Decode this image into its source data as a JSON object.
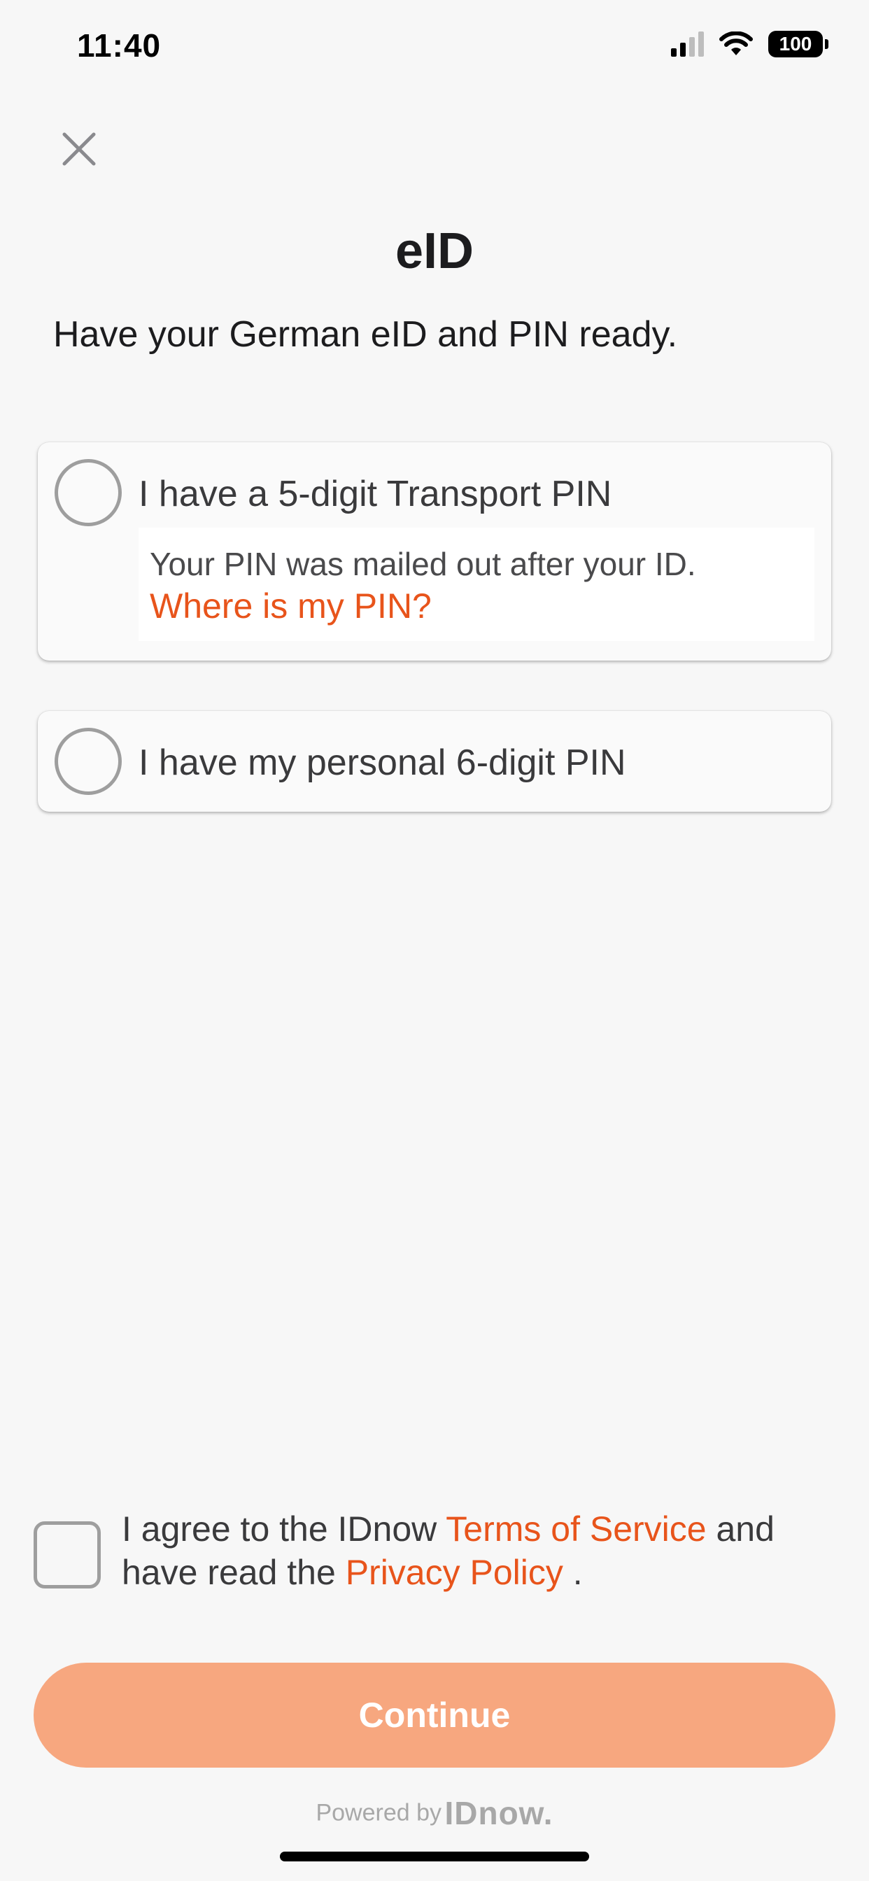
{
  "status_bar": {
    "time": "11:40",
    "battery": "100"
  },
  "header": {
    "title": "eID",
    "subtitle": "Have your German eID and PIN ready."
  },
  "options": [
    {
      "label": "I have a 5-digit Transport PIN",
      "hint": "Your PIN was mailed out after your ID.",
      "hint_link": "Where is my PIN?"
    },
    {
      "label": "I have my personal 6-digit PIN"
    }
  ],
  "agreement": {
    "prefix": "I agree to the IDnow ",
    "terms_link": "Terms of Service",
    "middle": " and have read the ",
    "privacy_link": "Privacy Policy",
    "suffix": " ."
  },
  "continue_label": "Continue",
  "footer": {
    "powered_by": "Powered by",
    "brand": "IDnow."
  },
  "colors": {
    "accent": "#e8541b",
    "button_disabled": "#f7a77f",
    "background": "#f7f7f7"
  },
  "icons": [
    "close-icon",
    "signal-icon",
    "wifi-icon",
    "battery-icon"
  ]
}
